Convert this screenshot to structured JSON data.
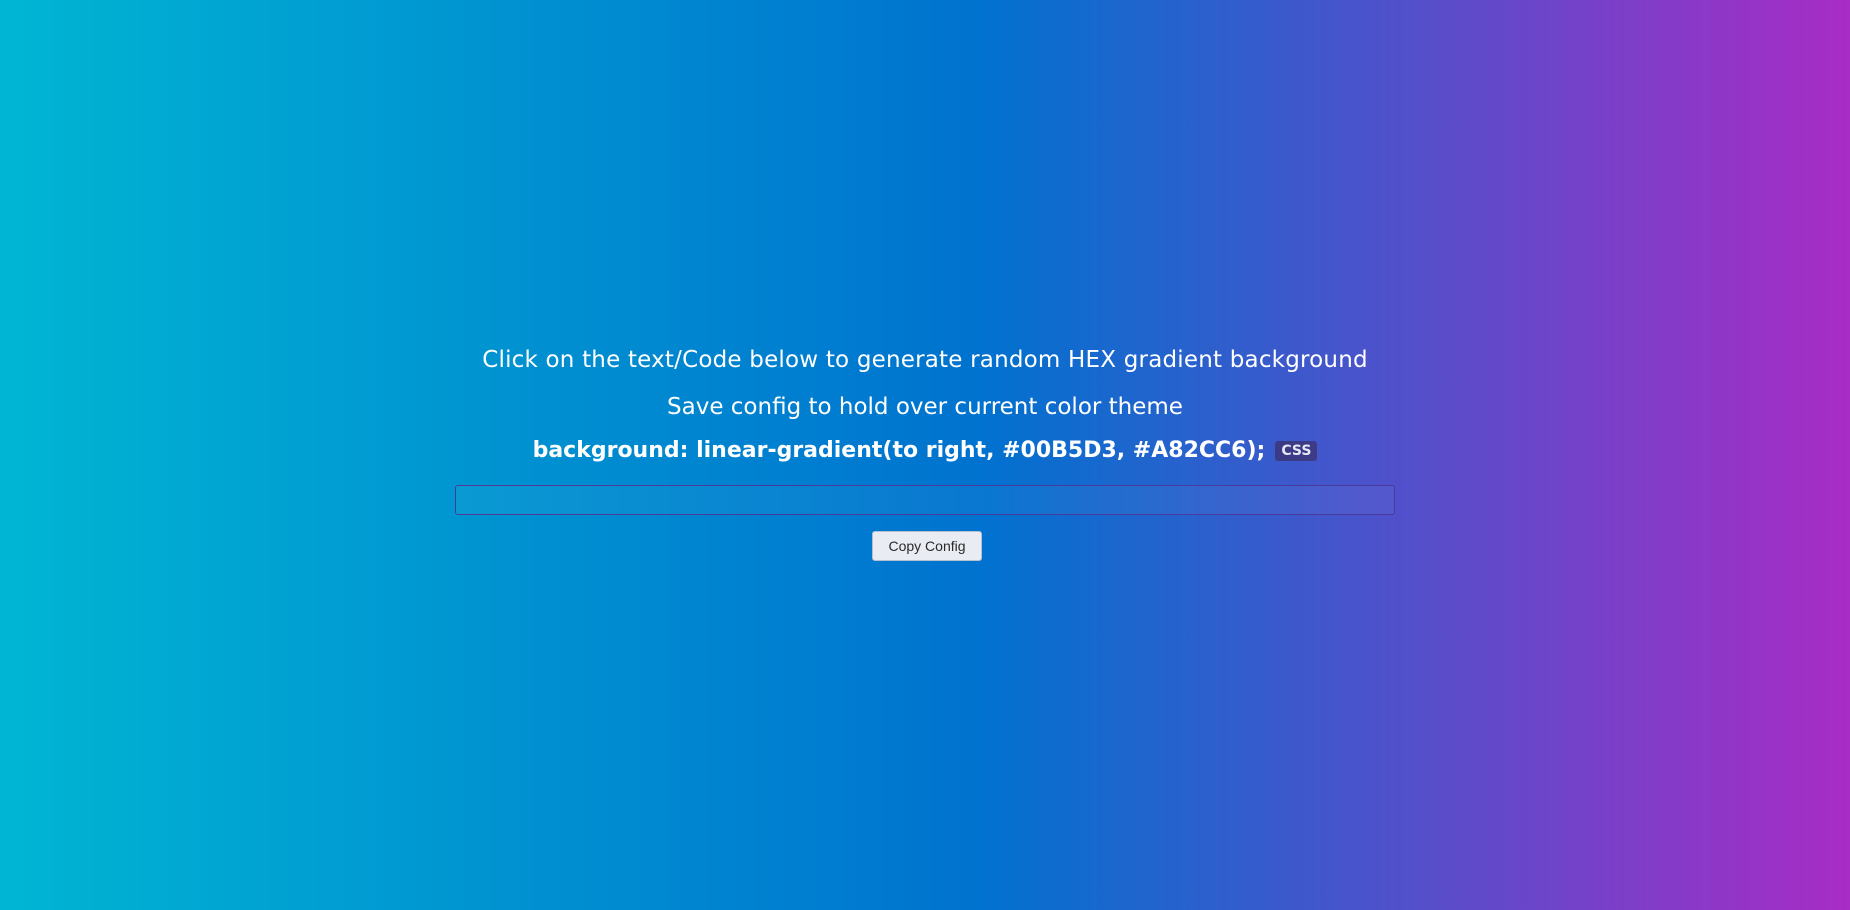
{
  "colors": {
    "gradient_left": "#00B5D3",
    "gradient_mid": "#0072CF",
    "gradient_right": "#A82CC6",
    "field_border": "#4A3B9B",
    "button_bg": "#E9ECF2"
  },
  "main": {
    "instruction": "Click on the text/Code below to generate random HEX gradient background",
    "helper": "Save config to hold over current color theme",
    "css_line": "background: linear-gradient(to right, #00B5D3, #A82CC6);",
    "css_tag": "CSS",
    "config_value": "",
    "copy_button": "Copy Config"
  }
}
